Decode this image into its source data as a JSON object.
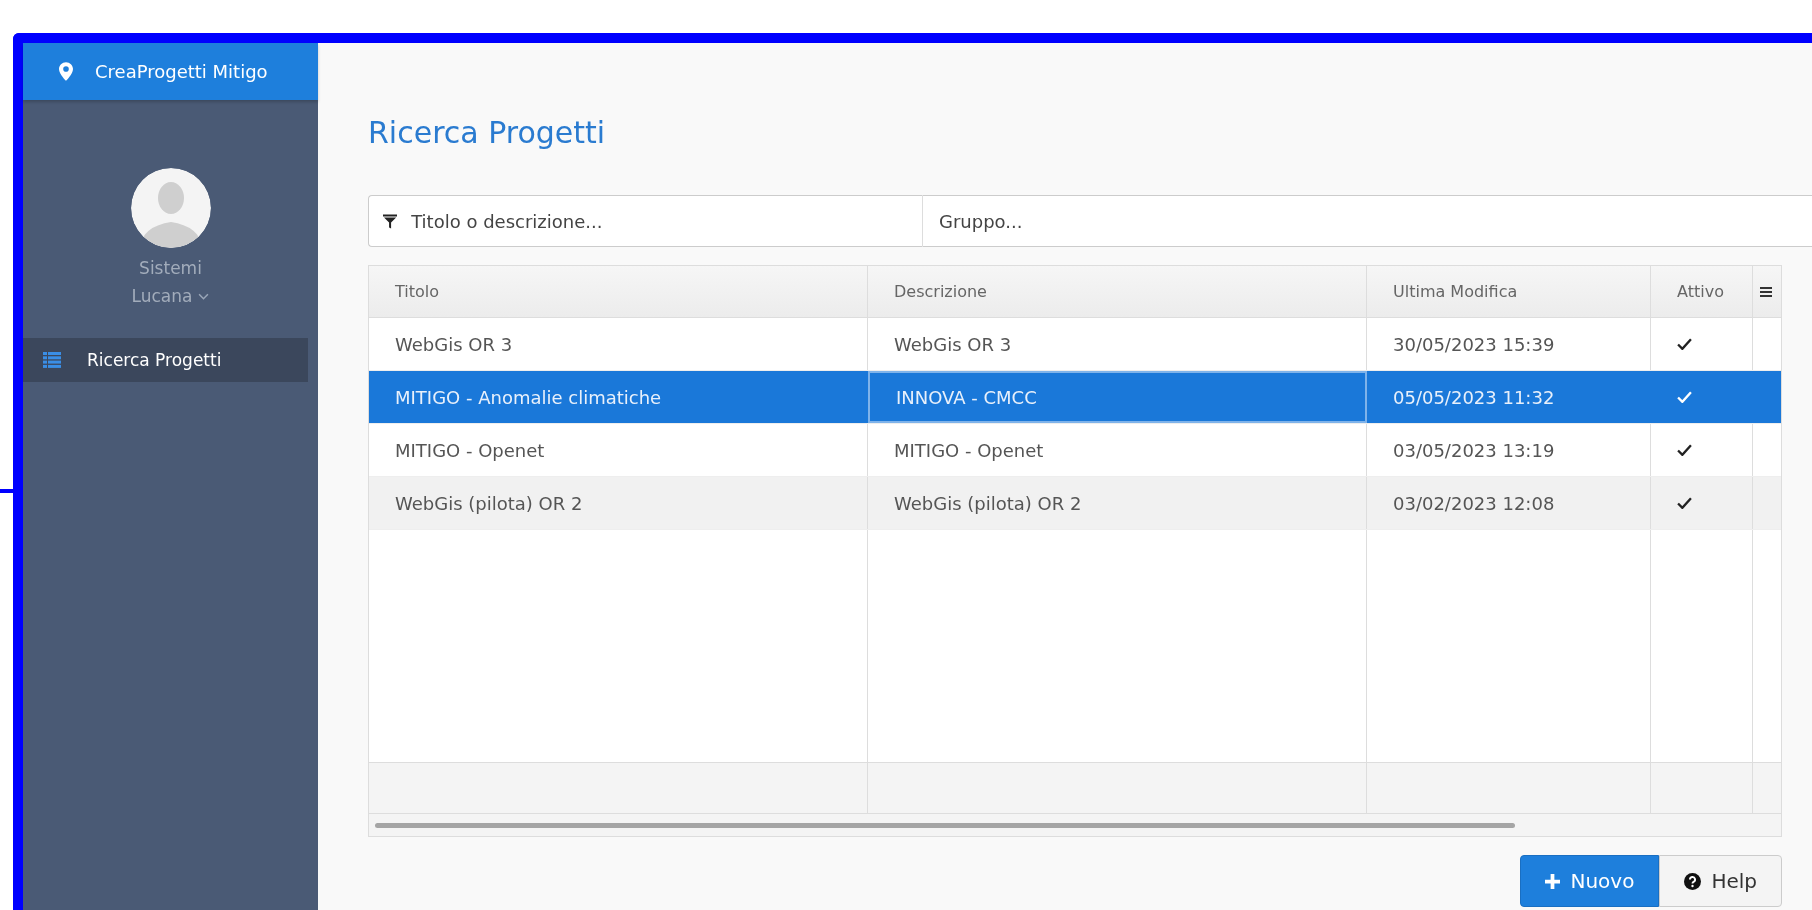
{
  "app": {
    "title": "CreaProgetti Mitigo"
  },
  "user": {
    "name_lines": [
      "Sistemi",
      "Lucana"
    ]
  },
  "sidebar": {
    "items": [
      {
        "label": "Ricerca Progetti",
        "selected": true
      }
    ]
  },
  "page": {
    "title": "Ricerca Progetti"
  },
  "filters": [
    {
      "placeholder": "Titolo o descrizione...",
      "kind": "filter"
    },
    {
      "placeholder": "Gruppo...",
      "kind": "plain"
    }
  ],
  "table": {
    "columns": [
      {
        "kind": "text",
        "label": "Titolo"
      },
      {
        "kind": "text",
        "label": "Descrizione"
      },
      {
        "kind": "text",
        "label": "Ultima Modifica"
      },
      {
        "kind": "check",
        "label": "Attivo"
      }
    ],
    "rows": [
      {
        "cells": [
          {
            "text": "WebGis OR 3",
            "focused": false
          },
          {
            "text": "WebGis OR 3",
            "focused": false
          },
          {
            "text": "30/05/2023 15:39",
            "focused": false
          }
        ],
        "active": true,
        "selected": false,
        "hovered": false
      },
      {
        "cells": [
          {
            "text": "MITIGO - Anomalie climatiche",
            "focused": false
          },
          {
            "text": "INNOVA - CMCC",
            "focused": true
          },
          {
            "text": "05/05/2023 11:32",
            "focused": false
          }
        ],
        "active": true,
        "selected": true,
        "hovered": false
      },
      {
        "cells": [
          {
            "text": "MITIGO - Openet",
            "focused": false
          },
          {
            "text": "MITIGO - Openet",
            "focused": false
          },
          {
            "text": "03/05/2023 13:19",
            "focused": false
          }
        ],
        "active": true,
        "selected": false,
        "hovered": false
      },
      {
        "cells": [
          {
            "text": "WebGis (pilota) OR 2",
            "focused": false
          },
          {
            "text": "WebGis (pilota) OR 2",
            "focused": false
          },
          {
            "text": "03/02/2023 12:08",
            "focused": false
          }
        ],
        "active": true,
        "selected": false,
        "hovered": true
      }
    ]
  },
  "buttons": [
    {
      "label": "Nuovo",
      "kind": "primary"
    },
    {
      "label": "Help",
      "kind": "help"
    }
  ]
}
